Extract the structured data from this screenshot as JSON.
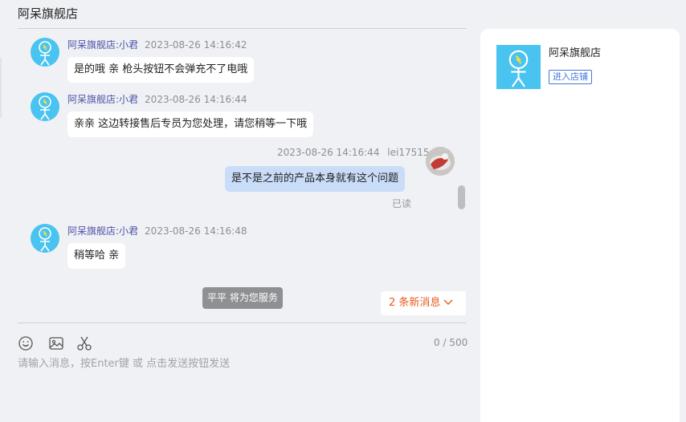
{
  "header": {
    "title": "阿呆旗舰店"
  },
  "messages": [
    {
      "sender": "阿呆旗舰店:小君",
      "time": "2023-08-26 14:16:42",
      "text": "是的哦 亲  枪头按钮不会弹充不了电哦"
    },
    {
      "sender": "阿呆旗舰店:小君",
      "time": "2023-08-26 14:16:44",
      "text": "亲亲 这边转接售后专员为您处理，请您稍等一下哦"
    },
    {
      "sender": "lei17515",
      "time": "2023-08-26 14:16:44",
      "text": "是不是之前的产品本身就有这个问题",
      "status": "已读"
    },
    {
      "sender": "阿呆旗舰店:小君",
      "time": "2023-08-26 14:16:48",
      "text": "稍等哈 亲"
    }
  ],
  "service_toast": "平平 将为您服务",
  "new_messages": "2 条新消息",
  "toolbar": {
    "icons": [
      "emoji-icon",
      "image-icon",
      "scissors-icon"
    ],
    "char_count": "0 / 500"
  },
  "input": {
    "placeholder": "请输入消息，按Enter键 或 点击发送按钮发送",
    "value": ""
  },
  "shop_card": {
    "name": "阿呆旗舰店",
    "enter_label": "进入店铺"
  },
  "colors": {
    "shop_blue": "#49c3f0",
    "sender_color": "#4c52a8",
    "my_bubble": "#c9dcf8",
    "new_msg_orange": "#e85a1e"
  }
}
